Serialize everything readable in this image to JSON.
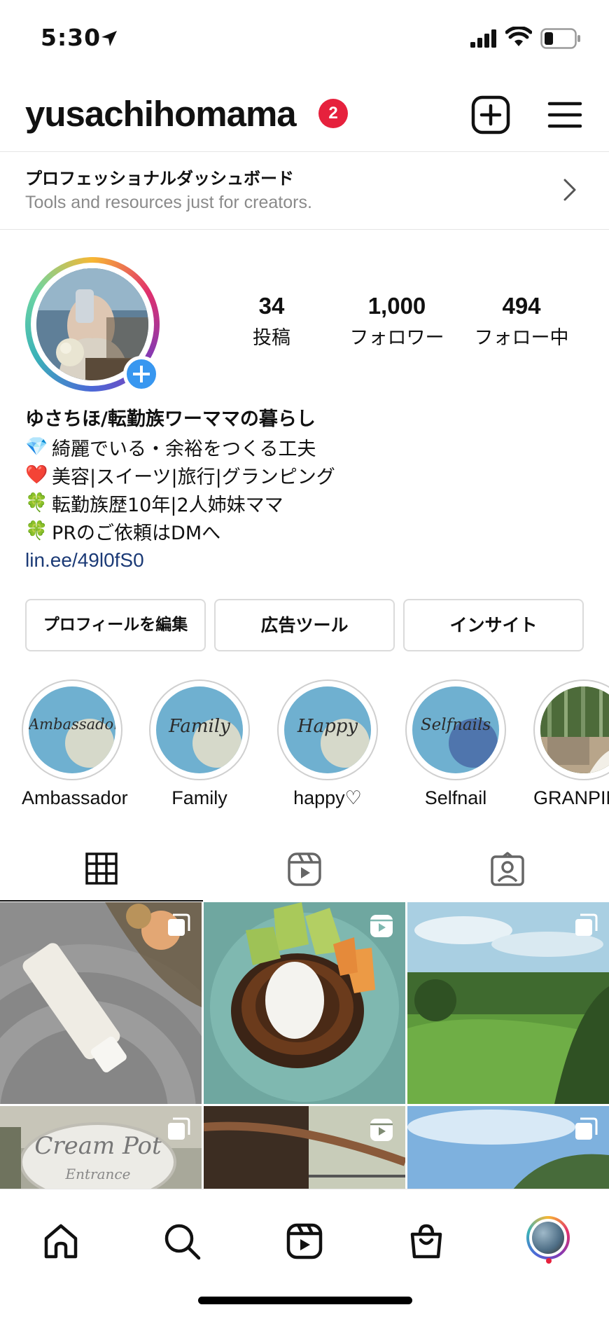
{
  "status_bar": {
    "time": "5:30"
  },
  "header": {
    "username": "yusachihomama",
    "notification_count": "2"
  },
  "dashboard": {
    "title": "プロフェッショナルダッシュボード",
    "subtitle": "Tools and resources just for creators."
  },
  "stats": [
    {
      "value": "34",
      "label": "投稿"
    },
    {
      "value": "1,000",
      "label": "フォロワー"
    },
    {
      "value": "494",
      "label": "フォロー中"
    }
  ],
  "bio": {
    "name": "ゆさちほ/転勤族ワーママの暮らし",
    "lines": [
      {
        "emoji": "💎",
        "text": "綺麗でいる・余裕をつくる工夫"
      },
      {
        "emoji": "❤️",
        "text": "美容|スイーツ|旅行|グランピング"
      },
      {
        "emoji": "🍀",
        "text": "転勤族歴10年|2人姉妹ママ"
      },
      {
        "emoji": "🍀",
        "text": "PRのご依頼はDMへ"
      }
    ],
    "link": "lin.ee/49l0fS0"
  },
  "buttons": {
    "edit_profile": "プロフィールを編集",
    "ad_tools": "広告ツール",
    "insights": "インサイト"
  },
  "highlights": [
    {
      "label": "Ambassador",
      "cover_text": "Ambassador"
    },
    {
      "label": "Family",
      "cover_text": "Family"
    },
    {
      "label": "happy♡",
      "cover_text": "Happy"
    },
    {
      "label": "Selfnail",
      "cover_text": "Selfnails"
    },
    {
      "label": "GRANPING",
      "cover_text": ""
    }
  ],
  "grid_posts": [
    {
      "type": "carousel",
      "subject": "cream-tube-on-mat"
    },
    {
      "type": "reel",
      "subject": "basque-cheesecake-with-melon"
    },
    {
      "type": "carousel",
      "subject": "green-landscape"
    },
    {
      "type": "carousel",
      "subject": "cream-pot-entrance-sign",
      "sign_text": "Cream Pot",
      "sign_sub": "Entrance"
    },
    {
      "type": "reel",
      "subject": "wicker-chair"
    },
    {
      "type": "carousel",
      "subject": "blue-sky"
    }
  ],
  "colors": {
    "notification_badge": "#e6213d",
    "add_story": "#3897f0",
    "link": "#1b3a76",
    "highlight_fill": "#6fb0d0"
  },
  "icons": [
    "location-arrow-icon",
    "signal-icon",
    "wifi-icon",
    "battery-icon",
    "add-post-icon",
    "menu-icon",
    "chevron-right-icon",
    "grid-icon",
    "reels-icon",
    "tagged-icon",
    "home-icon",
    "search-icon",
    "shop-icon"
  ]
}
